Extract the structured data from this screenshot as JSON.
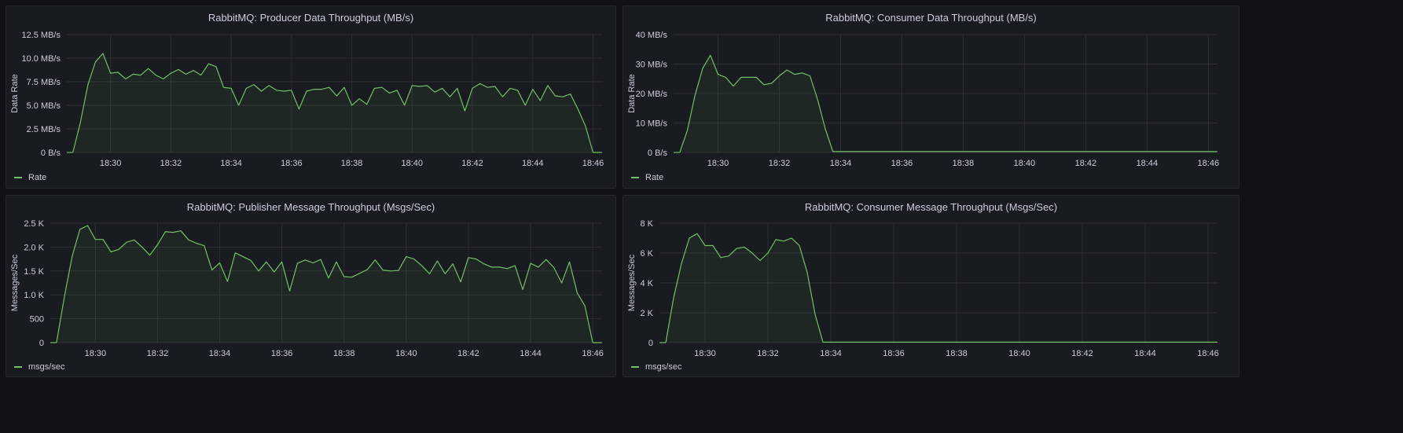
{
  "dashboard": {
    "panels": [
      {
        "title": "RabbitMQ: Producer Data Throughput (MB/s)",
        "legend": "Rate",
        "color": "#73bf69"
      },
      {
        "title": "RabbitMQ: Consumer Data Throughput (MB/s)",
        "legend": "Rate",
        "color": "#73bf69"
      },
      {
        "title": "RabbitMQ: Publisher Message Throughput (Msgs/Sec)",
        "legend": "msgs/sec",
        "color": "#73bf69"
      },
      {
        "title": "RabbitMQ: Consumer Message Throughput (Msgs/Sec)",
        "legend": "msgs/sec",
        "color": "#73bf69"
      }
    ]
  },
  "chart_data": [
    {
      "type": "area",
      "title": "RabbitMQ: Producer Data Throughput (MB/s)",
      "xlabel": "",
      "ylabel": "Data Rate",
      "x_ticks": [
        "18:30",
        "18:32",
        "18:34",
        "18:36",
        "18:38",
        "18:40",
        "18:42",
        "18:44",
        "18:46"
      ],
      "y_ticks": [
        "0 B/s",
        "2.5 MB/s",
        "5.0 MB/s",
        "7.5 MB/s",
        "10.0 MB/s",
        "12.5 MB/s"
      ],
      "ylim": [
        0,
        12.5
      ],
      "xlim_minutes": [
        "18:28.55",
        "18:46.30"
      ],
      "grid": true,
      "legend_position": "bottom-left",
      "series": [
        {
          "name": "Rate",
          "x": [
            "18:28.75",
            "18:29.0",
            "18:29.25",
            "18:29.5",
            "18:29.75",
            "18:30.0",
            "18:30.25",
            "18:30.5",
            "18:30.75",
            "18:31.0",
            "18:31.25",
            "18:31.5",
            "18:31.75",
            "18:32.0",
            "18:32.25",
            "18:32.5",
            "18:32.75",
            "18:33.0",
            "18:33.25",
            "18:33.5",
            "18:33.75",
            "18:34.0",
            "18:34.25",
            "18:34.5",
            "18:34.75",
            "18:35.0",
            "18:35.25",
            "18:35.5",
            "18:35.75",
            "18:36.0",
            "18:36.25",
            "18:36.5",
            "18:36.75",
            "18:37.0",
            "18:37.25",
            "18:37.5",
            "18:37.75",
            "18:38.0",
            "18:38.25",
            "18:38.5",
            "18:38.75",
            "18:39.0",
            "18:39.25",
            "18:39.5",
            "18:39.75",
            "18:40.0",
            "18:40.25",
            "18:40.5",
            "18:40.75",
            "18:41.0",
            "18:41.25",
            "18:41.5",
            "18:41.75",
            "18:42.0",
            "18:42.25",
            "18:42.5",
            "18:42.75",
            "18:43.0",
            "18:43.25",
            "18:43.5",
            "18:43.75",
            "18:44.0",
            "18:44.25",
            "18:44.5",
            "18:44.75",
            "18:45.0",
            "18:45.25",
            "18:45.5",
            "18:45.75",
            "18:46.0",
            "18:46.25"
          ],
          "values": [
            0.0,
            3.2,
            7.2,
            9.6,
            10.5,
            8.4,
            8.5,
            7.8,
            8.3,
            8.2,
            8.9,
            8.2,
            7.8,
            8.4,
            8.8,
            8.3,
            8.7,
            8.2,
            9.4,
            9.1,
            6.9,
            6.8,
            5.0,
            6.8,
            7.2,
            6.5,
            7.1,
            6.6,
            6.5,
            6.6,
            4.6,
            6.5,
            6.7,
            6.7,
            6.9,
            6.0,
            6.9,
            5.0,
            5.7,
            5.1,
            6.8,
            6.9,
            6.3,
            6.6,
            5.0,
            7.1,
            7.0,
            7.1,
            6.4,
            6.8,
            5.9,
            6.8,
            4.4,
            6.8,
            7.3,
            6.9,
            7.0,
            5.9,
            6.8,
            6.6,
            5.0,
            6.7,
            5.5,
            7.1,
            6.0,
            5.9,
            6.2,
            4.6,
            2.8,
            0.0,
            0.0
          ]
        }
      ]
    },
    {
      "type": "area",
      "title": "RabbitMQ: Consumer Data Throughput (MB/s)",
      "xlabel": "",
      "ylabel": "Data Rate",
      "x_ticks": [
        "18:30",
        "18:32",
        "18:34",
        "18:36",
        "18:38",
        "18:40",
        "18:42",
        "18:44",
        "18:46"
      ],
      "y_ticks": [
        "0 B/s",
        "10 MB/s",
        "20 MB/s",
        "30 MB/s",
        "40 MB/s"
      ],
      "ylim": [
        0,
        40
      ],
      "grid": true,
      "legend_position": "bottom-left",
      "series": [
        {
          "name": "Rate",
          "x": [
            "18:28.75",
            "18:29.0",
            "18:29.25",
            "18:29.5",
            "18:29.75",
            "18:30.0",
            "18:30.25",
            "18:30.5",
            "18:30.75",
            "18:31.0",
            "18:31.25",
            "18:31.5",
            "18:31.75",
            "18:32.0",
            "18:32.25",
            "18:32.5",
            "18:32.75",
            "18:33.0",
            "18:33.25",
            "18:33.5",
            "18:33.75",
            "18:34.0",
            "18:35.0",
            "18:36.0",
            "18:37.0",
            "18:38.0",
            "18:39.0",
            "18:40.0",
            "18:41.0",
            "18:42.0",
            "18:43.0",
            "18:44.0",
            "18:45.0",
            "18:46.0",
            "18:46.25"
          ],
          "values": [
            0.0,
            7.5,
            19.5,
            28.5,
            33.0,
            26.5,
            25.5,
            22.5,
            25.5,
            25.5,
            25.5,
            23.0,
            23.5,
            26.0,
            28.0,
            26.5,
            27.0,
            26.0,
            18.0,
            8.0,
            0.3,
            0.3,
            0.3,
            0.3,
            0.3,
            0.3,
            0.3,
            0.3,
            0.3,
            0.3,
            0.3,
            0.3,
            0.3,
            0.3,
            0.3
          ]
        }
      ]
    },
    {
      "type": "area",
      "title": "RabbitMQ: Publisher Message Throughput (Msgs/Sec)",
      "xlabel": "",
      "ylabel": "Messages/Sec",
      "x_ticks": [
        "18:30",
        "18:32",
        "18:34",
        "18:36",
        "18:38",
        "18:40",
        "18:42",
        "18:44",
        "18:46"
      ],
      "y_ticks": [
        "0",
        "500",
        "1.0 K",
        "1.5 K",
        "2.0 K",
        "2.5 K"
      ],
      "ylim": [
        0,
        2500
      ],
      "grid": true,
      "legend_position": "bottom-left",
      "series": [
        {
          "name": "msgs/sec",
          "x": [
            "18:28.75",
            "18:29.0",
            "18:29.25",
            "18:29.5",
            "18:29.75",
            "18:30.0",
            "18:30.25",
            "18:30.5",
            "18:30.75",
            "18:31.0",
            "18:31.25",
            "18:31.5",
            "18:31.75",
            "18:32.0",
            "18:32.25",
            "18:32.5",
            "18:32.75",
            "18:33.0",
            "18:33.25",
            "18:33.5",
            "18:33.75",
            "18:34.0",
            "18:34.25",
            "18:34.5",
            "18:34.75",
            "18:35.0",
            "18:35.25",
            "18:35.5",
            "18:35.75",
            "18:36.0",
            "18:36.25",
            "18:36.5",
            "18:36.75",
            "18:37.0",
            "18:37.25",
            "18:37.5",
            "18:37.75",
            "18:38.0",
            "18:38.25",
            "18:38.5",
            "18:38.75",
            "18:39.0",
            "18:39.25",
            "18:39.5",
            "18:39.75",
            "18:40.0",
            "18:40.25",
            "18:40.5",
            "18:40.75",
            "18:41.0",
            "18:41.25",
            "18:41.5",
            "18:41.75",
            "18:42.0",
            "18:42.25",
            "18:42.5",
            "18:42.75",
            "18:43.0",
            "18:43.25",
            "18:43.5",
            "18:43.75",
            "18:44.0",
            "18:44.25",
            "18:44.5",
            "18:44.75",
            "18:45.0",
            "18:45.25",
            "18:45.5",
            "18:45.75",
            "18:46.0",
            "18:46.25"
          ],
          "values": [
            0,
            950,
            1800,
            2370,
            2450,
            2160,
            2160,
            1900,
            1950,
            2100,
            2150,
            2000,
            1830,
            2050,
            2320,
            2310,
            2340,
            2150,
            2080,
            2030,
            1520,
            1670,
            1280,
            1880,
            1800,
            1720,
            1500,
            1690,
            1480,
            1690,
            1080,
            1660,
            1730,
            1670,
            1740,
            1350,
            1690,
            1380,
            1370,
            1450,
            1530,
            1730,
            1520,
            1500,
            1510,
            1800,
            1750,
            1610,
            1440,
            1710,
            1440,
            1650,
            1270,
            1780,
            1750,
            1650,
            1580,
            1580,
            1550,
            1610,
            1110,
            1660,
            1580,
            1740,
            1570,
            1250,
            1690,
            1040,
            770,
            0,
            0
          ]
        }
      ]
    },
    {
      "type": "area",
      "title": "RabbitMQ: Consumer Message Throughput (Msgs/Sec)",
      "xlabel": "",
      "ylabel": "Messages/Sec",
      "x_ticks": [
        "18:30",
        "18:32",
        "18:34",
        "18:36",
        "18:38",
        "18:40",
        "18:42",
        "18:44",
        "18:46"
      ],
      "y_ticks": [
        "0",
        "2 K",
        "4 K",
        "6 K",
        "8 K"
      ],
      "ylim": [
        0,
        8000
      ],
      "grid": true,
      "legend_position": "bottom-left",
      "series": [
        {
          "name": "msgs/sec",
          "x": [
            "18:28.75",
            "18:29.0",
            "18:29.25",
            "18:29.5",
            "18:29.75",
            "18:30.0",
            "18:30.25",
            "18:30.5",
            "18:30.75",
            "18:31.0",
            "18:31.25",
            "18:31.5",
            "18:31.75",
            "18:32.0",
            "18:32.25",
            "18:32.5",
            "18:32.75",
            "18:33.0",
            "18:33.25",
            "18:33.5",
            "18:33.75",
            "18:34.0",
            "18:35.0",
            "18:36.0",
            "18:37.0",
            "18:38.0",
            "18:39.0",
            "18:40.0",
            "18:41.0",
            "18:42.0",
            "18:43.0",
            "18:44.0",
            "18:45.0",
            "18:46.0",
            "18:46.25"
          ],
          "values": [
            0,
            3000,
            5300,
            7000,
            7300,
            6500,
            6500,
            5700,
            5800,
            6300,
            6400,
            6000,
            5500,
            6000,
            6900,
            6800,
            7000,
            6500,
            4700,
            1900,
            30,
            30,
            30,
            30,
            30,
            30,
            30,
            30,
            30,
            30,
            30,
            30,
            30,
            30,
            30
          ]
        }
      ]
    }
  ]
}
